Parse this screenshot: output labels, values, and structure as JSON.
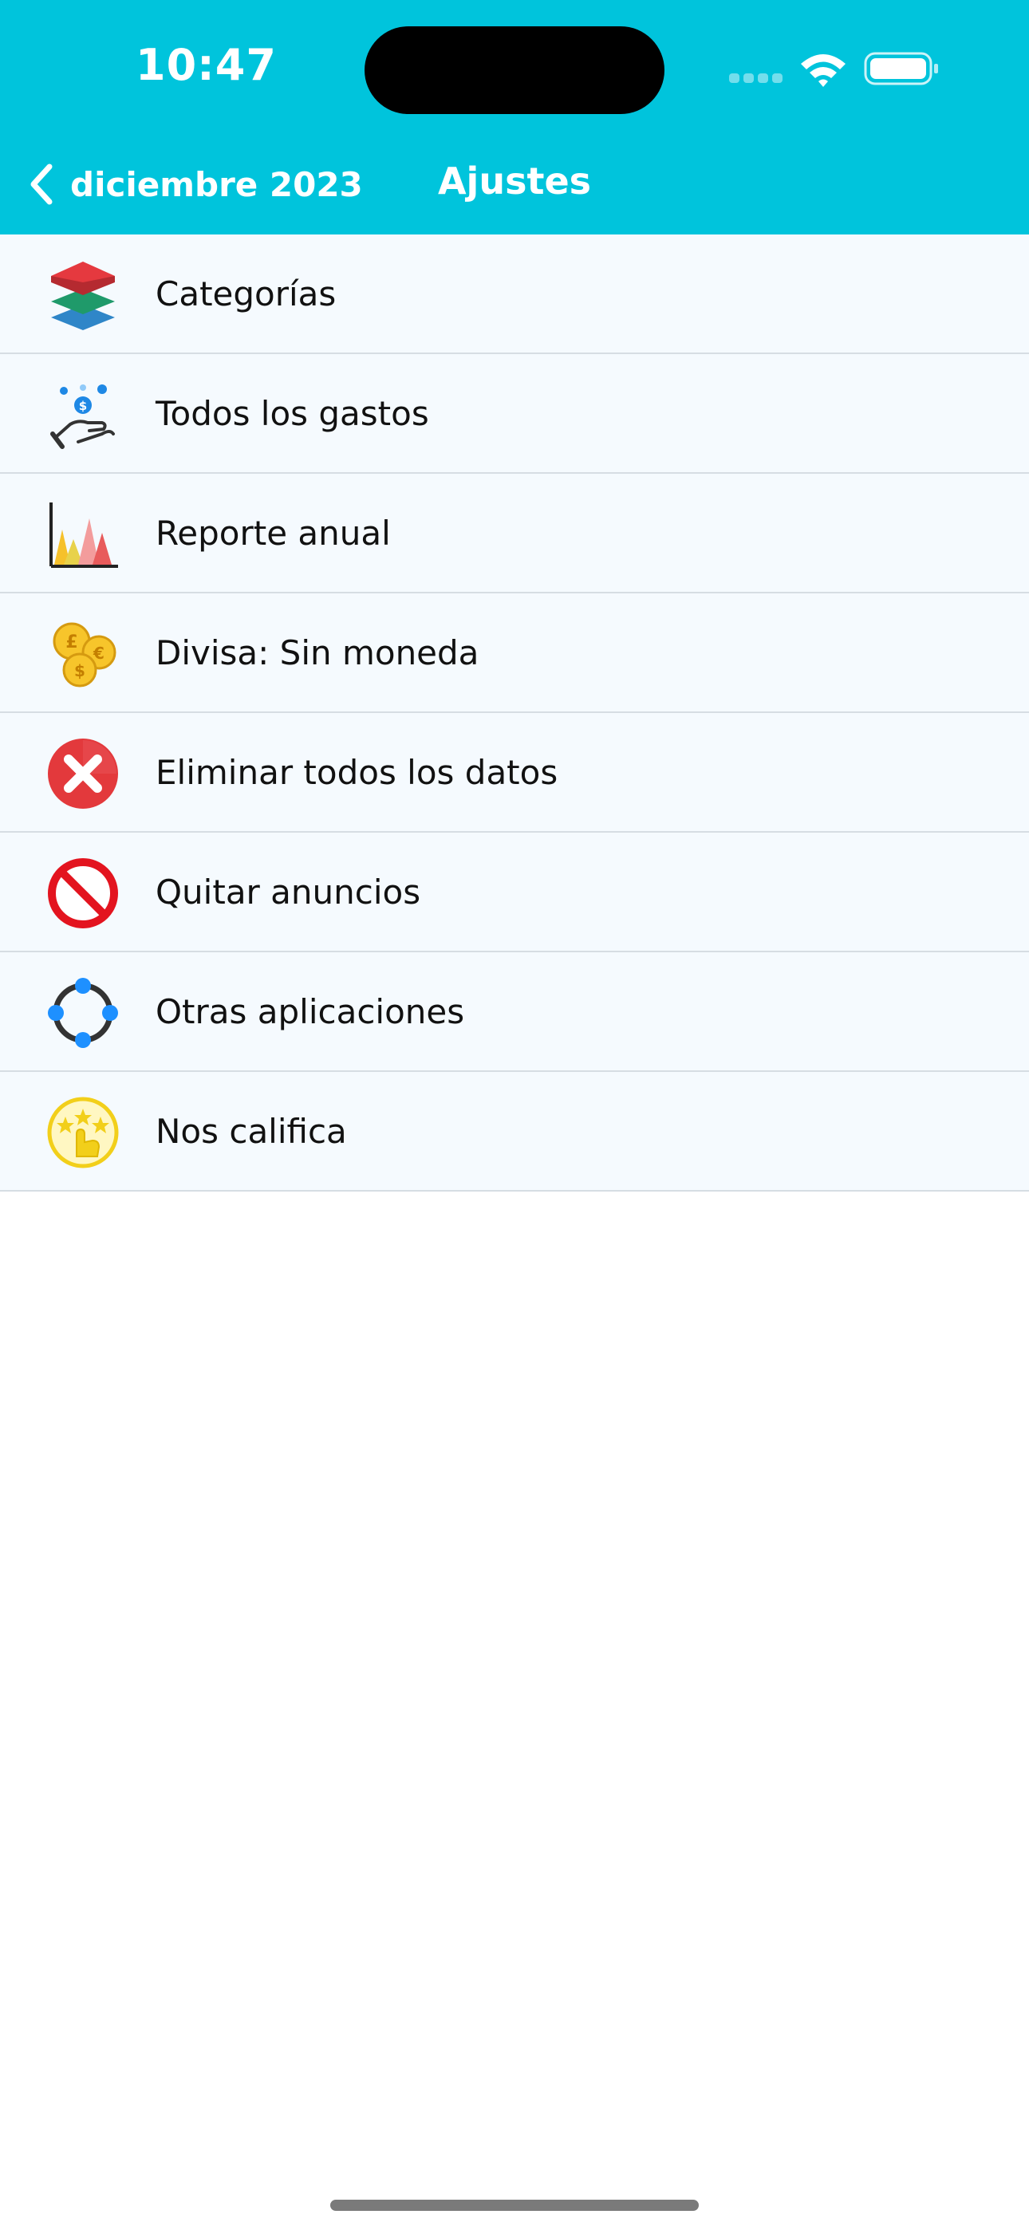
{
  "status_bar": {
    "time": "10:47"
  },
  "nav_bar": {
    "back_label": "diciembre 2023",
    "title": "Ajustes"
  },
  "settings": {
    "items": [
      {
        "label": "Categorías",
        "icon": "layers-icon"
      },
      {
        "label": "Todos los gastos",
        "icon": "hand-money-icon"
      },
      {
        "label": "Reporte anual",
        "icon": "chart-icon"
      },
      {
        "label": "Divisa: Sin moneda",
        "icon": "coins-icon"
      },
      {
        "label": "Eliminar todos los datos",
        "icon": "delete-icon"
      },
      {
        "label": "Quitar anuncios",
        "icon": "no-ads-icon"
      },
      {
        "label": "Otras aplicaciones",
        "icon": "apps-network-icon"
      },
      {
        "label": "Nos califica",
        "icon": "rate-icon"
      }
    ]
  },
  "colors": {
    "header": "#00c4dc",
    "row_background": "#f5fafe",
    "row_divider": "#d6dde3"
  }
}
